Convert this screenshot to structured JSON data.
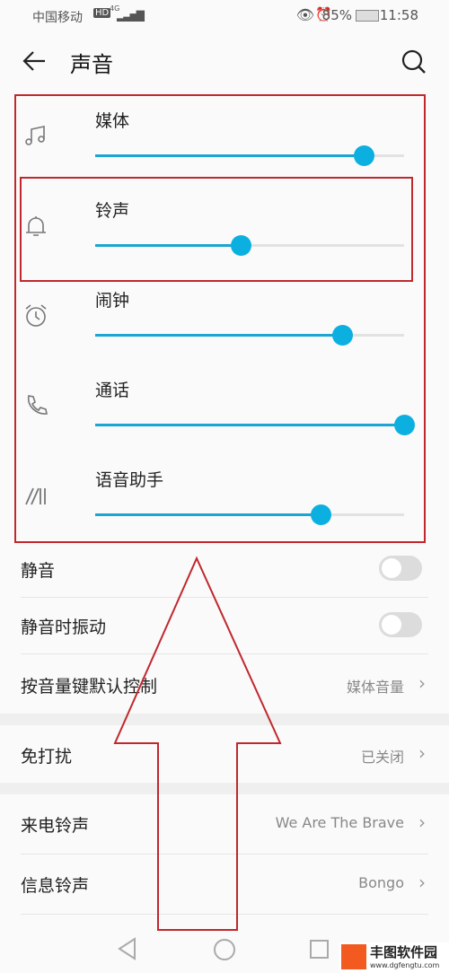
{
  "status_bar": {
    "carrier": "中国移动",
    "network": "4G",
    "battery": "85%",
    "time": "11:58"
  },
  "header": {
    "title": "声音"
  },
  "volumes": [
    {
      "label": "媒体",
      "icon": "music-note-icon",
      "level": 0.87
    },
    {
      "label": "铃声",
      "icon": "bell-icon",
      "level": 0.47
    },
    {
      "label": "闹钟",
      "icon": "alarm-icon",
      "level": 0.8
    },
    {
      "label": "通话",
      "icon": "phone-icon",
      "level": 1.0
    },
    {
      "label": "语音助手",
      "icon": "voice-assistant-icon",
      "level": 0.73
    }
  ],
  "settings": {
    "mute": {
      "label": "静音",
      "on": false
    },
    "mute_vibrate": {
      "label": "静音时振动",
      "on": false
    },
    "volume_key": {
      "label": "按音量键默认控制",
      "value": "媒体音量"
    },
    "dnd": {
      "label": "免打扰",
      "value": "已关闭"
    },
    "ringtone": {
      "label": "来电铃声",
      "value": "We Are The Brave"
    },
    "message_tone": {
      "label": "信息铃声",
      "value": "Bongo"
    }
  },
  "watermark": {
    "name": "丰图软件园",
    "url": "www.dgfengtu.com"
  },
  "colors": {
    "accent": "#0bb0e0",
    "annotation": "#c0282e"
  }
}
